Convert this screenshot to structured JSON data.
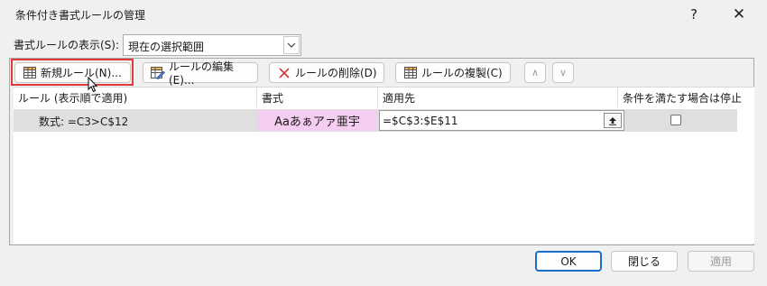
{
  "dialog": {
    "title": "条件付き書式ルールの管理",
    "help_label": "?",
    "close_label": "✕"
  },
  "scope": {
    "label": "書式ルールの表示(S):",
    "value": "現在の選択範囲"
  },
  "toolbar": {
    "new_rule": "新規ルール(N)...",
    "edit_rule": "ルールの編集(E)...",
    "delete_rule": "ルールの削除(D)",
    "duplicate_rule": "ルールの複製(C)",
    "move_up": "∧",
    "move_down": "∨"
  },
  "columns": [
    "ルール (表示順で適用)",
    "書式",
    "適用先",
    "条件を満たす場合は停止"
  ],
  "rules": [
    {
      "condition": "数式: =C3>C$12",
      "format_preview": "Aaあぁアァ亜宇",
      "applies_to": "=$C$3:$E$11",
      "stop_if_true": false
    }
  ],
  "buttons": {
    "ok": "OK",
    "close": "閉じる",
    "apply": "適用"
  },
  "colors": {
    "highlight": "#e03a3a",
    "preview_fill": "#f4cdf0",
    "ok_border": "#1b6fc9"
  },
  "icons": [
    "table-new-icon",
    "table-edit-icon",
    "delete-x-icon",
    "table-duplicate-icon",
    "range-select-icon"
  ]
}
